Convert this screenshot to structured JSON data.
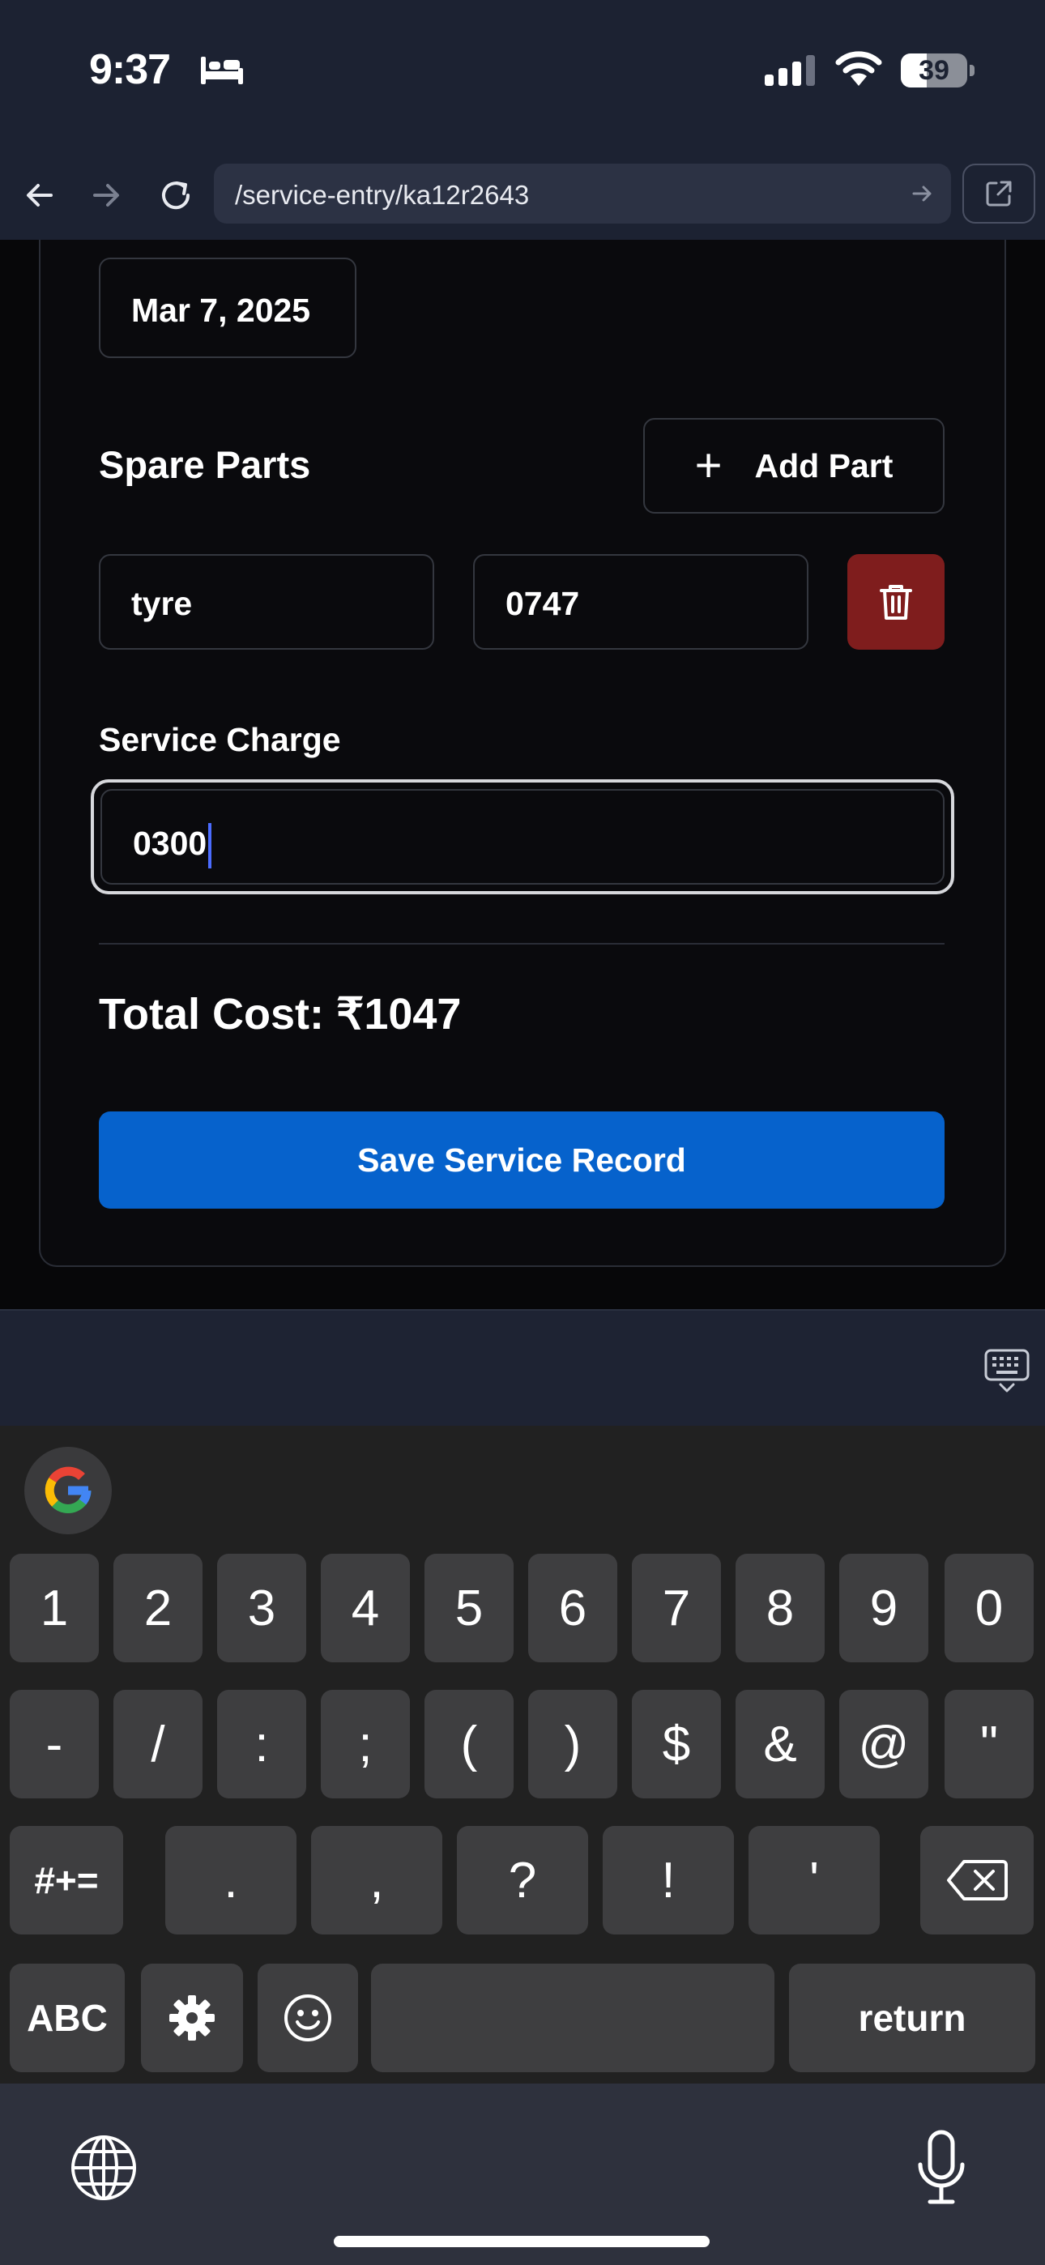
{
  "status_bar": {
    "time": "9:37",
    "battery_level": "39",
    "battery_fraction": 0.39,
    "icons": [
      "bed-icon",
      "signal-icon",
      "wifi-icon",
      "battery-icon"
    ]
  },
  "browser": {
    "url": "/service-entry/ka12r2643",
    "icons": [
      "back-arrow-icon",
      "forward-arrow-icon",
      "reload-icon",
      "go-arrow-icon",
      "external-link-icon"
    ]
  },
  "form": {
    "date_value": "Mar 7, 2025",
    "spare_parts_title": "Spare Parts",
    "add_part_label": "Add Part",
    "parts": [
      {
        "name": "tyre",
        "cost": "0747"
      }
    ],
    "service_charge_label": "Service Charge",
    "service_charge_value": "0300",
    "total_cost": "Total Cost: ₹1047",
    "save_label": "Save Service Record"
  },
  "keyboard": {
    "row1": [
      "1",
      "2",
      "3",
      "4",
      "5",
      "6",
      "7",
      "8",
      "9",
      "0"
    ],
    "row2": [
      "-",
      "/",
      ":",
      ";",
      "(",
      ")",
      "$",
      "&",
      "@",
      "\""
    ],
    "row3": [
      "#+=",
      ".",
      ",",
      "?",
      "!",
      "'"
    ],
    "row4": [
      "ABC",
      "",
      "",
      "",
      "return"
    ],
    "icons": [
      "google-icon",
      "keyboard-dismiss-icon",
      "backspace-icon",
      "settings-gear-icon",
      "emoji-icon",
      "globe-icon",
      "microphone-icon"
    ]
  },
  "colors": {
    "chrome_bg": "#1c2232",
    "page_bg": "#070709",
    "primary_button": "#0662cc",
    "delete_button": "#7f1d1d",
    "key_bg": "#3e3e40"
  }
}
